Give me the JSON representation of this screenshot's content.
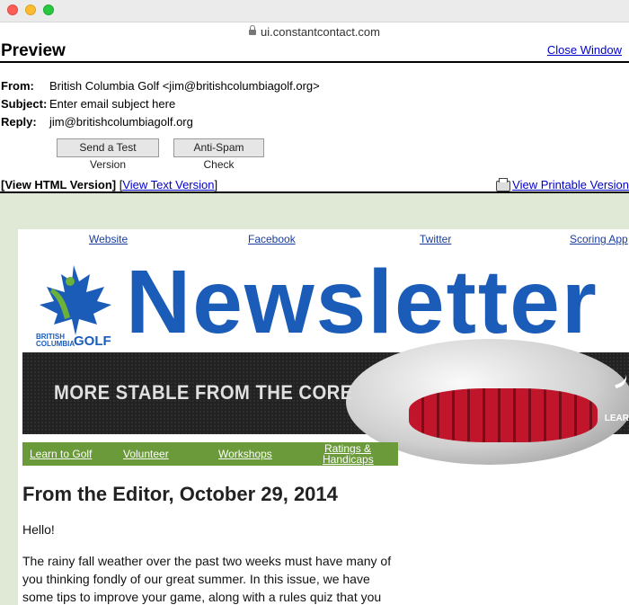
{
  "browser": {
    "url": "ui.constantcontact.com"
  },
  "header": {
    "title": "Preview",
    "close_label": "Close Window"
  },
  "meta": {
    "from_label": "From:",
    "from_value": "British Columbia Golf <jim@britishcolumbiagolf.org>",
    "subject_label": "Subject:",
    "subject_value": "Enter email subject here",
    "reply_label": "Reply:",
    "reply_value": "jim@britishcolumbiagolf.org"
  },
  "buttons": {
    "test_label": "Send a Test Version",
    "spam_label": "Anti-Spam Check"
  },
  "viewbar": {
    "html_label": "[View HTML Version]",
    "open_bracket": " [",
    "text_link": "View Text Version",
    "close_bracket": "]",
    "printable_link": "View Printable Version"
  },
  "email": {
    "toplinks": [
      "Website",
      "Facebook",
      "Twitter",
      "Scoring App"
    ],
    "logo_line1": "BRITISH",
    "logo_line2": "COLUMBIA",
    "logo_golf": "GOLF",
    "newsletter_word": "Newsletter",
    "banner_text": "MORE STABLE FROM THE CORE",
    "banner_learn": "LEAR",
    "nav": [
      "Learn to Golf",
      "Volunteer",
      "Workshops",
      "Ratings &",
      "Handicaps"
    ],
    "editor_title": "From the Editor, October 29, 2014",
    "hello": "Hello!",
    "para_lines": [
      "The rainy fall weather over the past two weeks must have many of",
      "you thinking fondly of our great summer.  In this issue, we have",
      "some tips to improve your game, along with a rules quiz that you"
    ]
  },
  "colors": {
    "brand_blue": "#1a5cb8",
    "nav_green": "#6b9a3b",
    "bg_green": "#dfe9d5",
    "link_blue": "#0000cc"
  }
}
